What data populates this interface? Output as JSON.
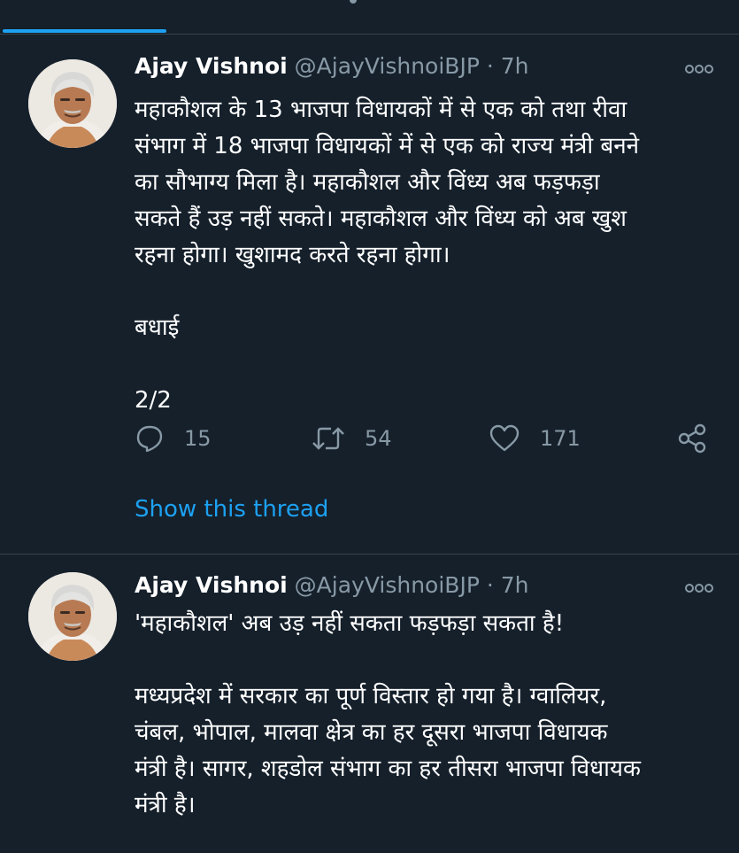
{
  "tweets": [
    {
      "author_name": "Ajay Vishnoi",
      "handle": "@AjayVishnoiBJP",
      "separator": "·",
      "time": "7h",
      "text": "महाकौशल के 13 भाजपा विधायकों में से एक को तथा रीवा\nसंभाग में 18 भाजपा विधायकों में से एक को राज्य मंत्री बनने\nका सौभाग्य मिला है। महाकौशल और विंध्य अब फड़फड़ा\nसकते हैं उड़ नहीं सकते। महाकौशल और विंध्य को अब खुश\nरहना होगा। खुशामद करते रहना होगा।\n\nबधाई\n\n2/2",
      "reply_count": "15",
      "retweet_count": "54",
      "like_count": "171",
      "show_thread": "Show this thread"
    },
    {
      "author_name": "Ajay Vishnoi",
      "handle": "@AjayVishnoiBJP",
      "separator": "·",
      "time": "7h",
      "text": "'महाकौशल' अब उड़ नहीं सकता फड़फड़ा सकता है!\n\nमध्यप्रदेश में सरकार का पूर्ण विस्तार हो गया है। ग्वालियर,\nचंबल, भोपाल, मालवा क्षेत्र का हर दूसरा भाजपा विधायक\nमंत्री है। सागर, शहडोल संभाग का हर तीसरा भाजपा विधायक\nमंत्री है।"
    }
  ],
  "icons": {
    "more": "more-horizontal-icon",
    "reply": "reply-icon",
    "retweet": "retweet-icon",
    "like": "heart-icon",
    "share": "share-icon"
  },
  "colors": {
    "background": "#15202b",
    "text": "#ffffff",
    "muted": "#8899a6",
    "accent": "#1da1f2",
    "border": "#38444d"
  }
}
